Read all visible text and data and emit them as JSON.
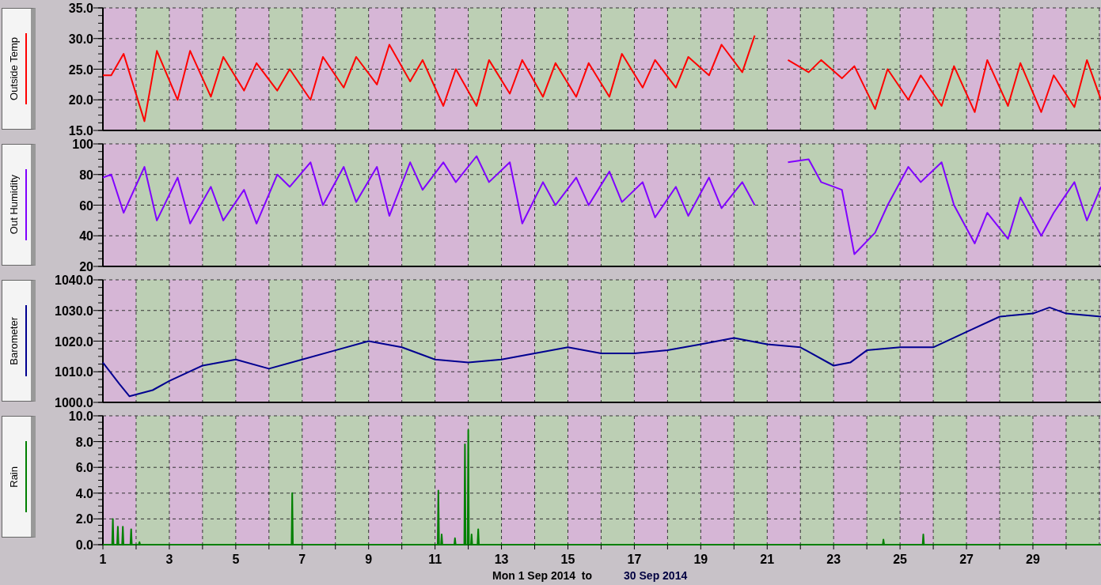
{
  "panels": [
    {
      "chart_data": {
        "type": "line",
        "grid": true,
        "xlim": [
          1,
          31.05
        ],
        "ylim": [
          15,
          35
        ],
        "yticks": [
          {
            "value": 15,
            "label": "15.0"
          },
          {
            "value": 20,
            "label": "20.0"
          },
          {
            "value": 25,
            "label": "25.0"
          },
          {
            "value": 30,
            "label": "30.0"
          },
          {
            "value": 35,
            "label": "35.0"
          }
        ],
        "x": [
          1,
          1.25,
          1.625,
          2.25,
          2.625,
          3.25,
          3.625,
          4.25,
          4.625,
          5.25,
          5.625,
          6.25,
          6.625,
          7.25,
          7.625,
          8.25,
          8.625,
          9.25,
          9.625,
          10.25,
          10.625,
          11.25,
          11.625,
          12.25,
          12.625,
          13.25,
          13.625,
          14.25,
          14.625,
          15.25,
          15.625,
          16.25,
          16.625,
          17.25,
          17.625,
          18.25,
          18.625,
          19.25,
          19.625,
          20.25,
          20.625,
          21.25,
          21.625,
          22.25,
          22.625,
          23.25,
          23.625,
          24.25,
          24.625,
          25.25,
          25.625,
          26.25,
          26.625,
          27.25,
          27.625,
          28.25,
          28.625,
          29.25,
          29.625,
          30.25,
          30.625,
          31.05
        ],
        "series": [
          {
            "name": "Outside Temp",
            "color": "#ff0000",
            "values": [
              24,
              24,
              27.5,
              16.5,
              28,
              20,
              28,
              20.5,
              27,
              21.5,
              26,
              21.5,
              25,
              20,
              27,
              22,
              27,
              22.5,
              29,
              23,
              26.5,
              19,
              25,
              19,
              26.5,
              21,
              26.5,
              20.5,
              26,
              20.5,
              26,
              20.5,
              27.5,
              22,
              26.5,
              22,
              27,
              24,
              29,
              24.5,
              30.5,
              null,
              26.5,
              24.5,
              26.5,
              23.5,
              25.5,
              18.5,
              25,
              20,
              24,
              19,
              25.5,
              18,
              26.5,
              19,
              26,
              18,
              24,
              18.8,
              26.5,
              20
            ]
          }
        ]
      }
    },
    {
      "chart_data": {
        "type": "line",
        "grid": true,
        "xlim": [
          1,
          31.05
        ],
        "ylim": [
          20,
          100
        ],
        "yticks": [
          {
            "value": 20,
            "label": "20"
          },
          {
            "value": 40,
            "label": "40"
          },
          {
            "value": 60,
            "label": "60"
          },
          {
            "value": 80,
            "label": "80"
          },
          {
            "value": 100,
            "label": "100"
          }
        ],
        "x": [
          1,
          1.25,
          1.625,
          2.25,
          2.625,
          3.25,
          3.625,
          4.25,
          4.625,
          5.25,
          5.625,
          6.25,
          6.625,
          7.25,
          7.625,
          8.25,
          8.625,
          9.25,
          9.625,
          10.25,
          10.625,
          11.25,
          11.625,
          12.25,
          12.625,
          13.25,
          13.625,
          14.25,
          14.625,
          15.25,
          15.625,
          16.25,
          16.625,
          17.25,
          17.625,
          18.25,
          18.625,
          19.25,
          19.625,
          20.25,
          20.625,
          21.25,
          21.625,
          22.25,
          22.625,
          23.25,
          23.625,
          24.25,
          24.625,
          25.25,
          25.625,
          26.25,
          26.625,
          27.25,
          27.625,
          28.25,
          28.625,
          29.25,
          29.625,
          30.25,
          30.625,
          31.05
        ],
        "series": [
          {
            "name": "Out Humidity",
            "color": "#8000ff",
            "values": [
              78,
              80,
              55,
              85,
              50,
              78,
              48,
              72,
              50,
              70,
              48,
              80,
              72,
              88,
              60,
              85,
              62,
              85,
              53,
              88,
              70,
              88,
              75,
              92,
              75,
              88,
              48,
              75,
              60,
              78,
              60,
              82,
              62,
              75,
              52,
              72,
              53,
              78,
              58,
              75,
              60,
              null,
              88,
              90,
              75,
              70,
              28,
              42,
              60,
              85,
              75,
              88,
              60,
              35,
              55,
              38,
              65,
              40,
              55,
              75,
              50,
              72
            ]
          }
        ]
      }
    },
    {
      "chart_data": {
        "type": "line",
        "grid": true,
        "xlim": [
          1,
          31.05
        ],
        "ylim": [
          1000,
          1040
        ],
        "yticks": [
          {
            "value": 1000,
            "label": "1000.0"
          },
          {
            "value": 1010,
            "label": "1010.0"
          },
          {
            "value": 1020,
            "label": "1020.0"
          },
          {
            "value": 1030,
            "label": "1030.0"
          },
          {
            "value": 1040,
            "label": "1040.0"
          }
        ],
        "x": [
          1,
          1.5,
          1.8,
          2.5,
          3,
          4,
          5,
          6,
          7,
          8,
          9,
          10,
          11,
          12,
          13,
          14,
          15,
          16,
          17,
          18,
          19,
          20,
          21,
          22,
          23,
          23.5,
          24,
          25,
          26,
          27,
          28,
          29,
          29.5,
          30,
          31.05
        ],
        "series": [
          {
            "name": "Barometer",
            "color": "#000090",
            "values": [
              1013,
              1006,
              1002,
              1004,
              1007,
              1012,
              1014,
              1011,
              1014,
              1017,
              1020,
              1018,
              1014,
              1013,
              1014,
              1016,
              1018,
              1016,
              1016,
              1017,
              1019,
              1021,
              1019,
              1018,
              1012,
              1013,
              1017,
              1018,
              1018,
              1023,
              1028,
              1029,
              1031,
              1029,
              1028
            ]
          }
        ]
      }
    },
    {
      "chart_data": {
        "type": "line",
        "grid": true,
        "xlim": [
          1,
          31.05
        ],
        "ylim": [
          0,
          10
        ],
        "yticks": [
          {
            "value": 0,
            "label": "0.0"
          },
          {
            "value": 2,
            "label": "2.0"
          },
          {
            "value": 4,
            "label": "4.0"
          },
          {
            "value": 6,
            "label": "6.0"
          },
          {
            "value": 8,
            "label": "8.0"
          },
          {
            "value": 10,
            "label": "10.0"
          }
        ],
        "xticks": [
          1,
          3,
          5,
          7,
          9,
          11,
          13,
          15,
          17,
          19,
          21,
          23,
          25,
          27,
          29
        ],
        "x": [
          1,
          1.28,
          1.3,
          1.32,
          1.43,
          1.45,
          1.47,
          1.58,
          1.6,
          1.62,
          1.83,
          1.85,
          1.87,
          2.08,
          2.1,
          2.12,
          6.68,
          6.7,
          6.72,
          11.08,
          11.1,
          11.12,
          11.18,
          11.2,
          11.22,
          11.58,
          11.6,
          11.62,
          11.88,
          11.9,
          11.92,
          11.98,
          12,
          12.02,
          12.08,
          12.1,
          12.12,
          12.28,
          12.3,
          12.32,
          24.48,
          24.5,
          24.52,
          25.68,
          25.7,
          25.72,
          31.05
        ],
        "series": [
          {
            "name": "Rain",
            "color": "#008000",
            "values": [
              0,
              0,
              2,
              0,
              0,
              1.4,
              0,
              0,
              1.4,
              0,
              0,
              1.2,
              0,
              0,
              0.2,
              0,
              0,
              4,
              0,
              0,
              4.2,
              0,
              0,
              0.8,
              0,
              0,
              0.5,
              0,
              0,
              7.8,
              0,
              0,
              8.9,
              0,
              0,
              0.8,
              0,
              0,
              1.2,
              0,
              0,
              0.4,
              0,
              0,
              0.8,
              0,
              0
            ]
          }
        ]
      }
    }
  ],
  "footer": {
    "from": "Mon 1 Sep 2014  to",
    "to": "30 Sep 2014"
  }
}
